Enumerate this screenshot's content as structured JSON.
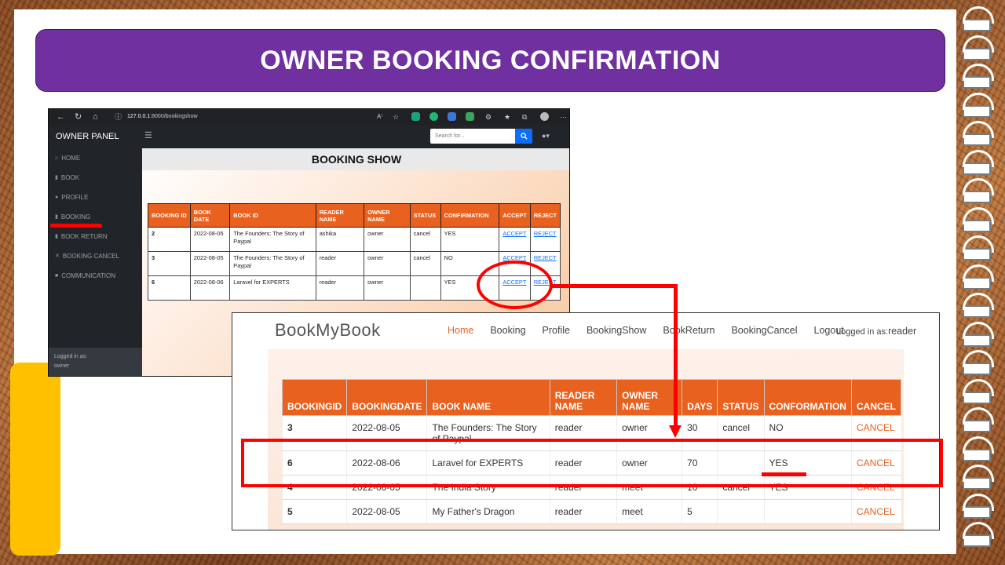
{
  "title": "OWNER BOOKING CONFIRMATION",
  "colors": {
    "banner": "#7030a0",
    "table_header": "#e8611e",
    "highlight": "#ff0000",
    "accent_tab": "#ffc000"
  },
  "browser": {
    "url_host": "127.0.0.1",
    "url_rest": ":8000/bookingshow"
  },
  "owner_panel": {
    "brand": "OWNER PANEL",
    "search_placeholder": "Search for...",
    "sidebar": [
      {
        "label": "HOME",
        "icon": "home-icon"
      },
      {
        "label": "BOOK",
        "icon": "book-icon"
      },
      {
        "label": "PROFILE",
        "icon": "user-icon"
      },
      {
        "label": "BOOKING",
        "icon": "bookmark-icon"
      },
      {
        "label": "BOOK RETURN",
        "icon": "book-icon"
      },
      {
        "label": "BOOKING CANCEL",
        "icon": "close-icon"
      },
      {
        "label": "COMMUNICATION",
        "icon": "chat-icon"
      }
    ],
    "footer_line1": "Logged in as:",
    "footer_line2": "owner",
    "heading": "BOOKING SHOW",
    "columns": [
      "BOOKING ID",
      "BOOK DATE",
      "BOOK ID",
      "READER NAME",
      "OWNER NAME",
      "STATUS",
      "CONFIRMATION",
      "ACCEPT",
      "REJECT"
    ],
    "rows": [
      {
        "id": "2",
        "date": "2022-08-05",
        "book": "The Founders: The Story of Paypal",
        "reader": "ashika",
        "owner": "owner",
        "status": "cancel",
        "confirmation": "YES",
        "accept": "ACCEPT",
        "reject": "REJECT"
      },
      {
        "id": "3",
        "date": "2022-08-05",
        "book": "The Founders: The Story of Paypal",
        "reader": "reader",
        "owner": "owner",
        "status": "cancel",
        "confirmation": "NO",
        "accept": "ACCEPT",
        "reject": "REJECT"
      },
      {
        "id": "6",
        "date": "2022-08-06",
        "book": "Laravel for EXPERTS",
        "reader": "reader",
        "owner": "owner",
        "status": "",
        "confirmation": "YES",
        "accept": "ACCEPT",
        "reject": "REJECT"
      }
    ]
  },
  "reader_site": {
    "logo": "BookMyBook",
    "menu": [
      "Home",
      "Booking",
      "Profile",
      "BookingShow",
      "BookReturn",
      "BookingCancel",
      "Logout"
    ],
    "logged_in_label": "Logged in as:",
    "logged_in_user": "reader",
    "columns": [
      "BOOKINGID",
      "BOOKINGDATE",
      "BOOK NAME",
      "READER NAME",
      "OWNER NAME",
      "DAYS",
      "STATUS",
      "CONFORMATION",
      "CANCEL"
    ],
    "rows": [
      {
        "id": "3",
        "date": "2022-08-05",
        "book": "The Founders: The Story of Paypal",
        "reader": "reader",
        "owner": "owner",
        "days": "30",
        "status": "cancel",
        "confirmation": "NO",
        "cancel": "CANCEL"
      },
      {
        "id": "6",
        "date": "2022-08-06",
        "book": "Laravel for EXPERTS",
        "reader": "reader",
        "owner": "owner",
        "days": "70",
        "status": "",
        "confirmation": "YES",
        "cancel": "CANCEL"
      },
      {
        "id": "4",
        "date": "2022-08-05",
        "book": "The India Story",
        "reader": "reader",
        "owner": "meet",
        "days": "10",
        "status": "cancel",
        "confirmation": "YES",
        "cancel": "CANCEL"
      },
      {
        "id": "5",
        "date": "2022-08-05",
        "book": "My Father's Dragon",
        "reader": "reader",
        "owner": "meet",
        "days": "5",
        "status": "",
        "confirmation": "",
        "cancel": "CANCEL"
      }
    ]
  }
}
